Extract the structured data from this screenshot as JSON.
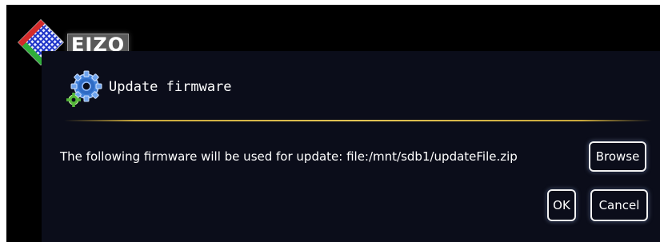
{
  "brand": {
    "logo_text": "EIZO"
  },
  "dialog": {
    "title": "Update firmware",
    "icon": "gear-icon",
    "message": "The following firmware will be used for update: file:/mnt/sdb1/updateFile.zip"
  },
  "buttons": {
    "browse_label": "Browse",
    "ok_label": "OK",
    "cancel_label": "Cancel"
  },
  "colors": {
    "background": "#000000",
    "panel": "#0b0d1a",
    "divider": "#c9a83c",
    "text": "#ffffff",
    "button_border": "#f2f2f2"
  }
}
